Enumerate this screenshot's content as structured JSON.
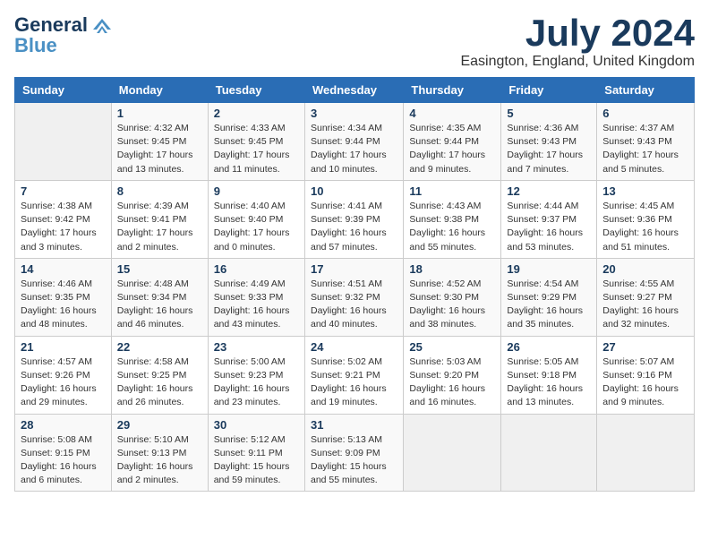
{
  "header": {
    "logo_line1": "General",
    "logo_line2": "Blue",
    "month_title": "July 2024",
    "location": "Easington, England, United Kingdom"
  },
  "days_of_week": [
    "Sunday",
    "Monday",
    "Tuesday",
    "Wednesday",
    "Thursday",
    "Friday",
    "Saturday"
  ],
  "weeks": [
    [
      {
        "day": "",
        "empty": true
      },
      {
        "day": "1",
        "sunrise": "Sunrise: 4:32 AM",
        "sunset": "Sunset: 9:45 PM",
        "daylight": "Daylight: 17 hours and 13 minutes."
      },
      {
        "day": "2",
        "sunrise": "Sunrise: 4:33 AM",
        "sunset": "Sunset: 9:45 PM",
        "daylight": "Daylight: 17 hours and 11 minutes."
      },
      {
        "day": "3",
        "sunrise": "Sunrise: 4:34 AM",
        "sunset": "Sunset: 9:44 PM",
        "daylight": "Daylight: 17 hours and 10 minutes."
      },
      {
        "day": "4",
        "sunrise": "Sunrise: 4:35 AM",
        "sunset": "Sunset: 9:44 PM",
        "daylight": "Daylight: 17 hours and 9 minutes."
      },
      {
        "day": "5",
        "sunrise": "Sunrise: 4:36 AM",
        "sunset": "Sunset: 9:43 PM",
        "daylight": "Daylight: 17 hours and 7 minutes."
      },
      {
        "day": "6",
        "sunrise": "Sunrise: 4:37 AM",
        "sunset": "Sunset: 9:43 PM",
        "daylight": "Daylight: 17 hours and 5 minutes."
      }
    ],
    [
      {
        "day": "7",
        "sunrise": "Sunrise: 4:38 AM",
        "sunset": "Sunset: 9:42 PM",
        "daylight": "Daylight: 17 hours and 3 minutes."
      },
      {
        "day": "8",
        "sunrise": "Sunrise: 4:39 AM",
        "sunset": "Sunset: 9:41 PM",
        "daylight": "Daylight: 17 hours and 2 minutes."
      },
      {
        "day": "9",
        "sunrise": "Sunrise: 4:40 AM",
        "sunset": "Sunset: 9:40 PM",
        "daylight": "Daylight: 17 hours and 0 minutes."
      },
      {
        "day": "10",
        "sunrise": "Sunrise: 4:41 AM",
        "sunset": "Sunset: 9:39 PM",
        "daylight": "Daylight: 16 hours and 57 minutes."
      },
      {
        "day": "11",
        "sunrise": "Sunrise: 4:43 AM",
        "sunset": "Sunset: 9:38 PM",
        "daylight": "Daylight: 16 hours and 55 minutes."
      },
      {
        "day": "12",
        "sunrise": "Sunrise: 4:44 AM",
        "sunset": "Sunset: 9:37 PM",
        "daylight": "Daylight: 16 hours and 53 minutes."
      },
      {
        "day": "13",
        "sunrise": "Sunrise: 4:45 AM",
        "sunset": "Sunset: 9:36 PM",
        "daylight": "Daylight: 16 hours and 51 minutes."
      }
    ],
    [
      {
        "day": "14",
        "sunrise": "Sunrise: 4:46 AM",
        "sunset": "Sunset: 9:35 PM",
        "daylight": "Daylight: 16 hours and 48 minutes."
      },
      {
        "day": "15",
        "sunrise": "Sunrise: 4:48 AM",
        "sunset": "Sunset: 9:34 PM",
        "daylight": "Daylight: 16 hours and 46 minutes."
      },
      {
        "day": "16",
        "sunrise": "Sunrise: 4:49 AM",
        "sunset": "Sunset: 9:33 PM",
        "daylight": "Daylight: 16 hours and 43 minutes."
      },
      {
        "day": "17",
        "sunrise": "Sunrise: 4:51 AM",
        "sunset": "Sunset: 9:32 PM",
        "daylight": "Daylight: 16 hours and 40 minutes."
      },
      {
        "day": "18",
        "sunrise": "Sunrise: 4:52 AM",
        "sunset": "Sunset: 9:30 PM",
        "daylight": "Daylight: 16 hours and 38 minutes."
      },
      {
        "day": "19",
        "sunrise": "Sunrise: 4:54 AM",
        "sunset": "Sunset: 9:29 PM",
        "daylight": "Daylight: 16 hours and 35 minutes."
      },
      {
        "day": "20",
        "sunrise": "Sunrise: 4:55 AM",
        "sunset": "Sunset: 9:27 PM",
        "daylight": "Daylight: 16 hours and 32 minutes."
      }
    ],
    [
      {
        "day": "21",
        "sunrise": "Sunrise: 4:57 AM",
        "sunset": "Sunset: 9:26 PM",
        "daylight": "Daylight: 16 hours and 29 minutes."
      },
      {
        "day": "22",
        "sunrise": "Sunrise: 4:58 AM",
        "sunset": "Sunset: 9:25 PM",
        "daylight": "Daylight: 16 hours and 26 minutes."
      },
      {
        "day": "23",
        "sunrise": "Sunrise: 5:00 AM",
        "sunset": "Sunset: 9:23 PM",
        "daylight": "Daylight: 16 hours and 23 minutes."
      },
      {
        "day": "24",
        "sunrise": "Sunrise: 5:02 AM",
        "sunset": "Sunset: 9:21 PM",
        "daylight": "Daylight: 16 hours and 19 minutes."
      },
      {
        "day": "25",
        "sunrise": "Sunrise: 5:03 AM",
        "sunset": "Sunset: 9:20 PM",
        "daylight": "Daylight: 16 hours and 16 minutes."
      },
      {
        "day": "26",
        "sunrise": "Sunrise: 5:05 AM",
        "sunset": "Sunset: 9:18 PM",
        "daylight": "Daylight: 16 hours and 13 minutes."
      },
      {
        "day": "27",
        "sunrise": "Sunrise: 5:07 AM",
        "sunset": "Sunset: 9:16 PM",
        "daylight": "Daylight: 16 hours and 9 minutes."
      }
    ],
    [
      {
        "day": "28",
        "sunrise": "Sunrise: 5:08 AM",
        "sunset": "Sunset: 9:15 PM",
        "daylight": "Daylight: 16 hours and 6 minutes."
      },
      {
        "day": "29",
        "sunrise": "Sunrise: 5:10 AM",
        "sunset": "Sunset: 9:13 PM",
        "daylight": "Daylight: 16 hours and 2 minutes."
      },
      {
        "day": "30",
        "sunrise": "Sunrise: 5:12 AM",
        "sunset": "Sunset: 9:11 PM",
        "daylight": "Daylight: 15 hours and 59 minutes."
      },
      {
        "day": "31",
        "sunrise": "Sunrise: 5:13 AM",
        "sunset": "Sunset: 9:09 PM",
        "daylight": "Daylight: 15 hours and 55 minutes."
      },
      {
        "day": "",
        "empty": true
      },
      {
        "day": "",
        "empty": true
      },
      {
        "day": "",
        "empty": true
      }
    ]
  ]
}
